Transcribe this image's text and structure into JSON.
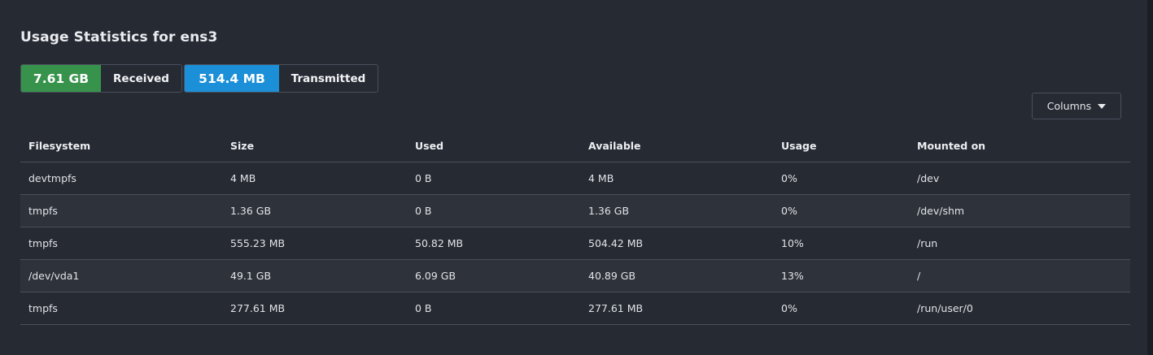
{
  "title": "Usage Statistics for ens3",
  "stats": {
    "received": {
      "value": "7.61 GB",
      "label": "Received",
      "color": "#37934b"
    },
    "transmitted": {
      "value": "514.4 MB",
      "label": "Transmitted",
      "color": "#1b8fd8"
    }
  },
  "columns_button": {
    "label": "Columns",
    "icon": "caret-down-icon"
  },
  "table": {
    "headers": [
      "Filesystem",
      "Size",
      "Used",
      "Available",
      "Usage",
      "Mounted on"
    ],
    "rows": [
      [
        "devtmpfs",
        "4 MB",
        "0 B",
        "4 MB",
        "0%",
        "/dev"
      ],
      [
        "tmpfs",
        "1.36 GB",
        "0 B",
        "1.36 GB",
        "0%",
        "/dev/shm"
      ],
      [
        "tmpfs",
        "555.23 MB",
        "50.82 MB",
        "504.42 MB",
        "10%",
        "/run"
      ],
      [
        "/dev/vda1",
        "49.1 GB",
        "6.09 GB",
        "40.89 GB",
        "13%",
        "/"
      ],
      [
        "tmpfs",
        "277.61 MB",
        "0 B",
        "277.61 MB",
        "0%",
        "/run/user/0"
      ]
    ]
  }
}
